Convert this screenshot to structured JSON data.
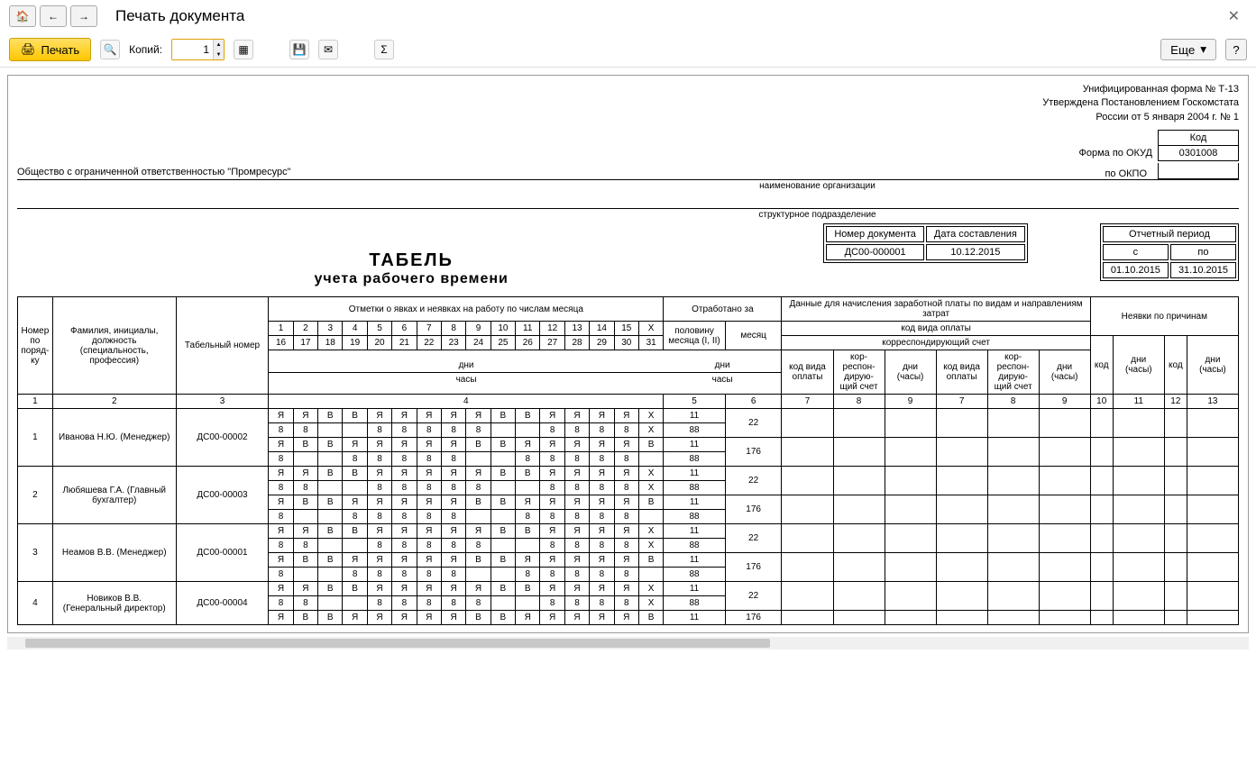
{
  "window": {
    "title": "Печать документа",
    "close": "✕"
  },
  "toolbar": {
    "print_label": "Печать",
    "copies_label": "Копий:",
    "copies_value": "1",
    "more_label": "Еще",
    "help_label": "?"
  },
  "form_header": {
    "line1": "Унифицированная форма № Т-13",
    "line2": "Утверждена Постановлением Госкомстата",
    "line3": "России от 5 января 2004 г. № 1",
    "kod_label": "Код",
    "okud_label": "Форма по ОКУД",
    "okud_value": "0301008",
    "okpo_label": "по ОКПО",
    "okpo_value": ""
  },
  "org_name": "Общество с ограниченной ответственностью \"Промресурс\"",
  "org_caption": "наименование организации",
  "unit_caption": "структурное подразделение",
  "title": {
    "main": "ТАБЕЛЬ",
    "sub": "учета  рабочего времени"
  },
  "docnum": {
    "num_label": "Номер документа",
    "date_label": "Дата составления",
    "num_value": "ДС00-000001",
    "date_value": "10.12.2015",
    "period_label": "Отчетный период",
    "from_label": "с",
    "to_label": "по",
    "from_value": "01.10.2015",
    "to_value": "31.10.2015"
  },
  "headers": {
    "col_num": "Номер по поряд-ку",
    "col_name": "Фамилия, инициалы, должность (специальность, профессия)",
    "col_tab": "Табельный номер",
    "col_marks": "Отметки о явках и неявках на работу по числам месяца",
    "col_worked": "Отработано за",
    "col_pay": "Данные для начисления заработной платы по видам и направлениям затрат",
    "col_absent": "Неявки по причинам",
    "half": "половину месяца (I, II)",
    "month": "месяц",
    "days": "дни",
    "hours": "часы",
    "pay_code_type": "код вида оплаты",
    "pay_corr_acc": "корреспондирующий счет",
    "pay_code": "код вида оплаты",
    "pay_corr": "кор-респон-дирую-щий счет",
    "pay_days": "дни (часы)",
    "abs_code": "код",
    "abs_days": "дни (часы)"
  },
  "day_nums_1": [
    "1",
    "2",
    "3",
    "4",
    "5",
    "6",
    "7",
    "8",
    "9",
    "10",
    "11",
    "12",
    "13",
    "14",
    "15",
    "Х"
  ],
  "day_nums_2": [
    "16",
    "17",
    "18",
    "19",
    "20",
    "21",
    "22",
    "23",
    "24",
    "25",
    "26",
    "27",
    "28",
    "29",
    "30",
    "31"
  ],
  "col_nums": [
    "1",
    "2",
    "3",
    "4",
    "5",
    "6",
    "7",
    "8",
    "9",
    "7",
    "8",
    "9",
    "10",
    "11",
    "12",
    "13"
  ],
  "employees": [
    {
      "num": "1",
      "name": "Иванова Н.Ю. (Менеджер)",
      "tab": "ДС00-00002",
      "rows": [
        {
          "days": [
            "Я",
            "Я",
            "В",
            "В",
            "Я",
            "Я",
            "Я",
            "Я",
            "Я",
            "В",
            "В",
            "Я",
            "Я",
            "Я",
            "Я",
            "Х"
          ],
          "half": "11"
        },
        {
          "days": [
            "8",
            "8",
            "",
            "",
            "8",
            "8",
            "8",
            "8",
            "8",
            "",
            "",
            "8",
            "8",
            "8",
            "8",
            "Х"
          ],
          "half": "88"
        },
        {
          "days": [
            "Я",
            "В",
            "В",
            "Я",
            "Я",
            "Я",
            "Я",
            "Я",
            "В",
            "В",
            "Я",
            "Я",
            "Я",
            "Я",
            "Я",
            "В"
          ],
          "half": "11"
        },
        {
          "days": [
            "8",
            "",
            "",
            "8",
            "8",
            "8",
            "8",
            "8",
            "",
            "",
            "8",
            "8",
            "8",
            "8",
            "8",
            ""
          ],
          "half": "88"
        }
      ],
      "month_days": "22",
      "month_hours": "176"
    },
    {
      "num": "2",
      "name": "Любяшева Г.А. (Главный бухгалтер)",
      "tab": "ДС00-00003",
      "rows": [
        {
          "days": [
            "Я",
            "Я",
            "В",
            "В",
            "Я",
            "Я",
            "Я",
            "Я",
            "Я",
            "В",
            "В",
            "Я",
            "Я",
            "Я",
            "Я",
            "Х"
          ],
          "half": "11"
        },
        {
          "days": [
            "8",
            "8",
            "",
            "",
            "8",
            "8",
            "8",
            "8",
            "8",
            "",
            "",
            "8",
            "8",
            "8",
            "8",
            "Х"
          ],
          "half": "88"
        },
        {
          "days": [
            "Я",
            "В",
            "В",
            "Я",
            "Я",
            "Я",
            "Я",
            "Я",
            "В",
            "В",
            "Я",
            "Я",
            "Я",
            "Я",
            "Я",
            "В"
          ],
          "half": "11"
        },
        {
          "days": [
            "8",
            "",
            "",
            "8",
            "8",
            "8",
            "8",
            "8",
            "",
            "",
            "8",
            "8",
            "8",
            "8",
            "8",
            ""
          ],
          "half": "88"
        }
      ],
      "month_days": "22",
      "month_hours": "176"
    },
    {
      "num": "3",
      "name": "Неамов В.В. (Менеджер)",
      "tab": "ДС00-00001",
      "rows": [
        {
          "days": [
            "Я",
            "Я",
            "В",
            "В",
            "Я",
            "Я",
            "Я",
            "Я",
            "Я",
            "В",
            "В",
            "Я",
            "Я",
            "Я",
            "Я",
            "Х"
          ],
          "half": "11"
        },
        {
          "days": [
            "8",
            "8",
            "",
            "",
            "8",
            "8",
            "8",
            "8",
            "8",
            "",
            "",
            "8",
            "8",
            "8",
            "8",
            "Х"
          ],
          "half": "88"
        },
        {
          "days": [
            "Я",
            "В",
            "В",
            "Я",
            "Я",
            "Я",
            "Я",
            "Я",
            "В",
            "В",
            "Я",
            "Я",
            "Я",
            "Я",
            "Я",
            "В"
          ],
          "half": "11"
        },
        {
          "days": [
            "8",
            "",
            "",
            "8",
            "8",
            "8",
            "8",
            "8",
            "",
            "",
            "8",
            "8",
            "8",
            "8",
            "8",
            ""
          ],
          "half": "88"
        }
      ],
      "month_days": "22",
      "month_hours": "176"
    },
    {
      "num": "4",
      "name": "Новиков В.В. (Генеральный директор)",
      "tab": "ДС00-00004",
      "rows": [
        {
          "days": [
            "Я",
            "Я",
            "В",
            "В",
            "Я",
            "Я",
            "Я",
            "Я",
            "Я",
            "В",
            "В",
            "Я",
            "Я",
            "Я",
            "Я",
            "Х"
          ],
          "half": "11"
        },
        {
          "days": [
            "8",
            "8",
            "",
            "",
            "8",
            "8",
            "8",
            "8",
            "8",
            "",
            "",
            "8",
            "8",
            "8",
            "8",
            "Х"
          ],
          "half": "88"
        },
        {
          "days": [
            "Я",
            "В",
            "В",
            "Я",
            "Я",
            "Я",
            "Я",
            "Я",
            "В",
            "В",
            "Я",
            "Я",
            "Я",
            "Я",
            "Я",
            "В"
          ],
          "half": "11"
        }
      ],
      "month_days": "22",
      "month_hours": "176"
    }
  ]
}
